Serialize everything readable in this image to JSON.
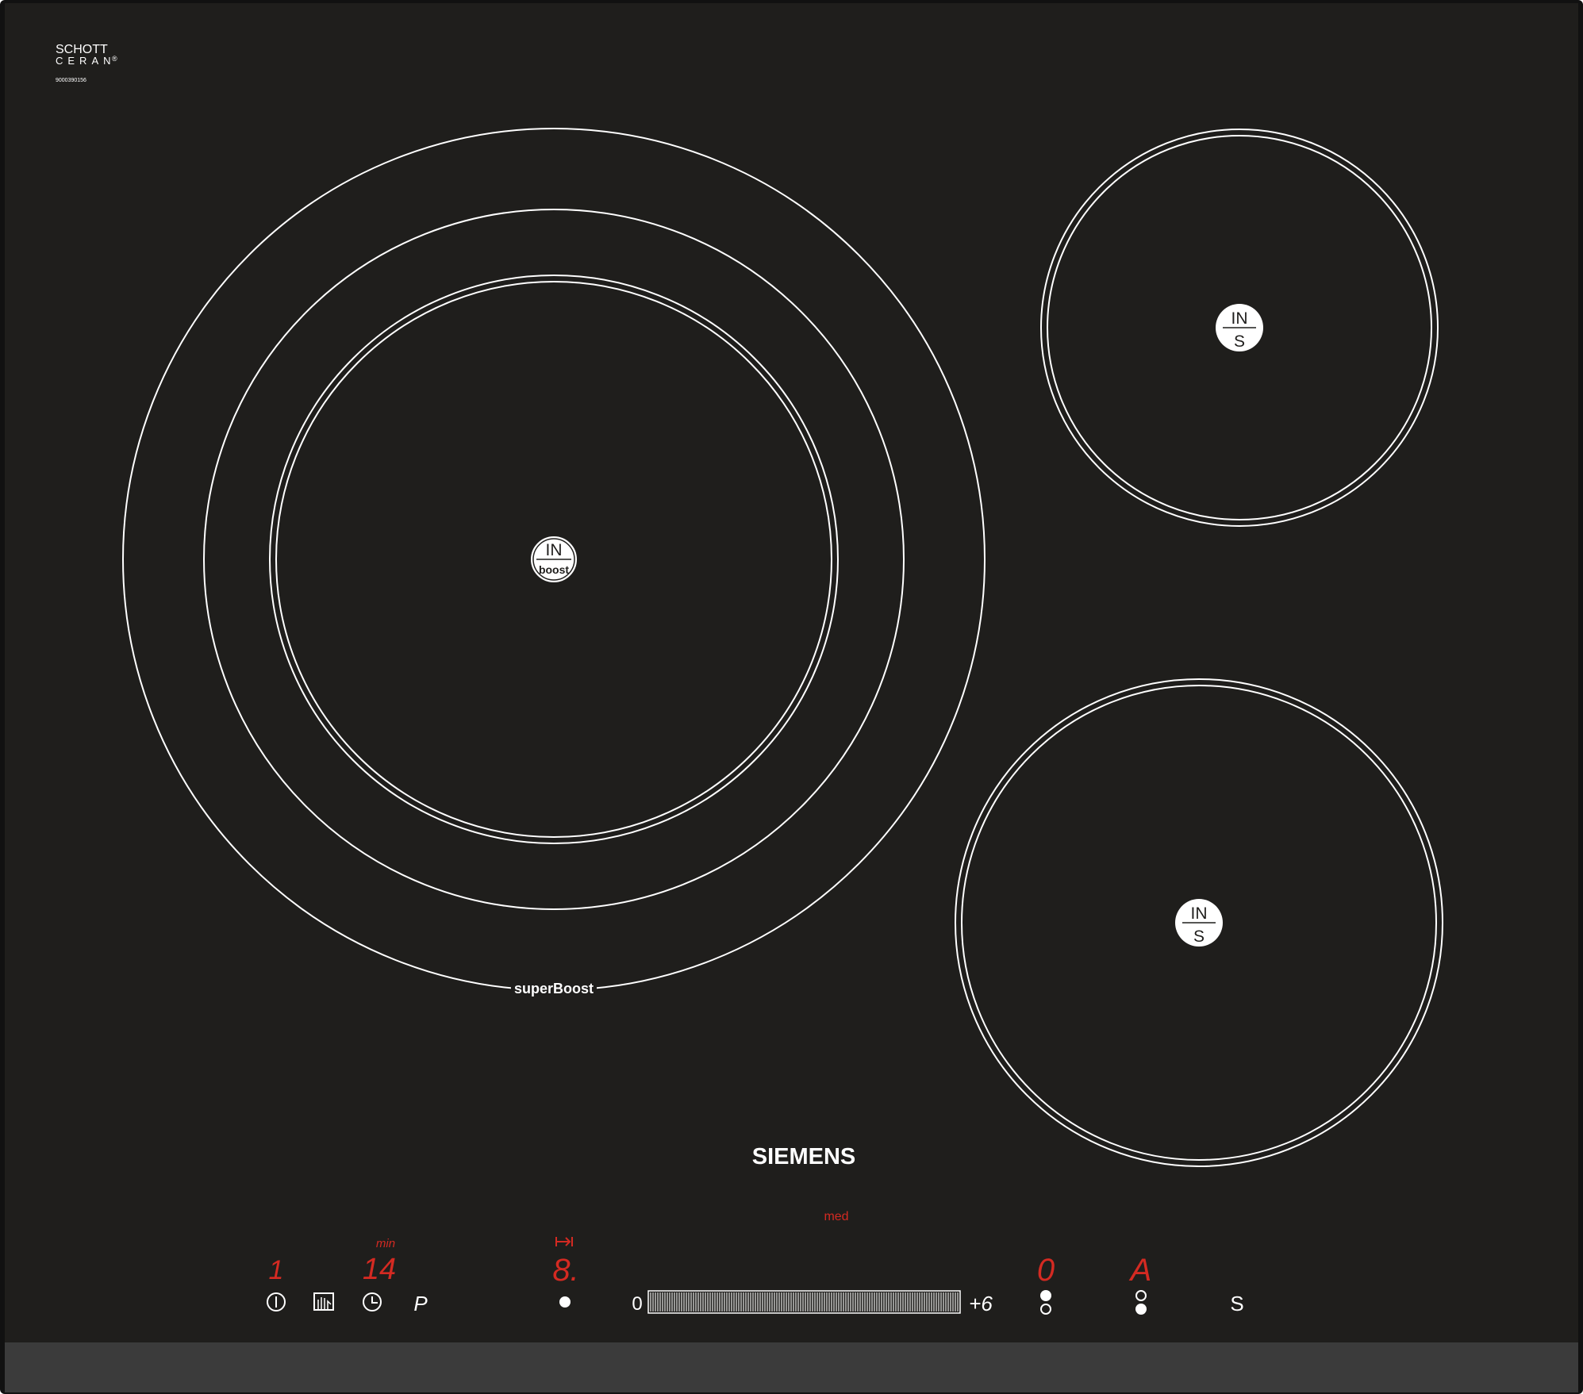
{
  "glass": {
    "maker_line1": "SCHOTT",
    "maker_line2": "CERAN",
    "registered_mark": "®",
    "serial": "9000390156"
  },
  "brand": {
    "logo": "SIEMENS"
  },
  "zones": {
    "large": {
      "badge_top": "IN",
      "badge_bottom": "boost",
      "ring_label": "superBoost"
    },
    "top_right": {
      "badge_top": "IN",
      "badge_bottom": "S"
    },
    "bottom_right": {
      "badge_top": "IN",
      "badge_bottom": "S"
    }
  },
  "controls": {
    "power_display": "1",
    "timer_unit": "min",
    "timer_display": "14",
    "zone_display": "8.",
    "zone_mode_label": "med",
    "slider_min_label": "0",
    "slider_max_label": "+6",
    "display_zone_a": "0",
    "display_zone_b": "A",
    "key_p_label": "P",
    "key_s_label": "S"
  },
  "icons": {
    "power": "power-icon",
    "wipe_protect": "hand-wipe-protect-icon",
    "timer": "clock-icon",
    "zone_select": "dot-icon",
    "move_to_end": "arrow-to-bar-icon"
  },
  "colors": {
    "glass": "#1f1e1c",
    "frame": "#111111",
    "bottom_trim": "#3b3b3b",
    "ring": "#ffffff",
    "led_red": "#d42a22"
  }
}
